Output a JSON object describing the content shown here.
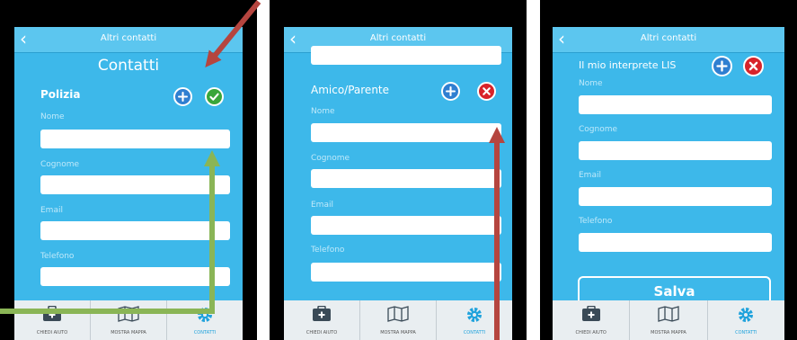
{
  "phones": [
    {
      "bar_title": "Altri contatti",
      "heading": "Contatti",
      "section": "Polizia",
      "fields": [
        {
          "label": "Nome",
          "value": ""
        },
        {
          "label": "Cognome",
          "value": ""
        },
        {
          "label": "Email",
          "value": ""
        },
        {
          "label": "Telefono",
          "value": ""
        }
      ],
      "actions": [
        "plus-icon",
        "check-icon"
      ]
    },
    {
      "bar_title": "Altri contatti",
      "section": "Amico/Parente",
      "fields": [
        {
          "label": "Nome",
          "value": ""
        },
        {
          "label": "Cognome",
          "value": ""
        },
        {
          "label": "Email",
          "value": ""
        },
        {
          "label": "Telefono",
          "value": ""
        }
      ],
      "actions": [
        "plus-icon",
        "close-icon"
      ]
    },
    {
      "bar_title": "Altri contatti",
      "section": "Il mio interprete LIS",
      "fields": [
        {
          "label": "Nome",
          "value": ""
        },
        {
          "label": "Cognome",
          "value": ""
        },
        {
          "label": "Email",
          "value": ""
        },
        {
          "label": "Telefono",
          "value": ""
        }
      ],
      "actions": [
        "plus-icon",
        "close-icon"
      ],
      "save_label": "Salva"
    }
  ],
  "nav": [
    {
      "label": "CHIEDI AIUTO",
      "icon": "first-aid-kit-icon"
    },
    {
      "label": "MOSTRA MAPPA",
      "icon": "map-icon"
    },
    {
      "label": "CONTATTI",
      "icon": "gear-icon"
    }
  ],
  "colors": {
    "screen_bg": "#3db8ea",
    "topbar": "#5cc6ef",
    "plus": "#2f7fd1",
    "check": "#3aa63a",
    "close": "#d8232a",
    "annotation_red": "#b5453f",
    "annotation_green": "#8ab556",
    "nav_active": "#1fa2dc"
  }
}
